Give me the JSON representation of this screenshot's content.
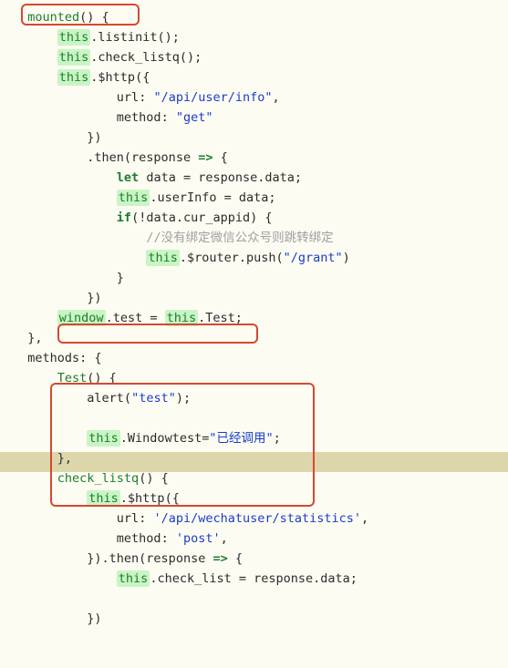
{
  "code": {
    "l1a": "mounted",
    "l1b": "() {",
    "l2a": "this",
    "l2b": ".listinit();",
    "l3a": "this",
    "l3b": ".check_listq();",
    "l4a": "this",
    "l4b": ".$http({",
    "l5a": "url",
    "l5b": ": ",
    "l5c": "\"/api/user/info\"",
    "l5d": ",",
    "l6a": "method",
    "l6b": ": ",
    "l6c": "\"get\"",
    "l7": "})",
    "l8a": ".then(response ",
    "l8b": "=>",
    "l8c": " {",
    "l9a": "let",
    "l9b": " data = response.data;",
    "l10a": "this",
    "l10b": ".userInfo = data;",
    "l11a": "if",
    "l11b": "(!data.cur_appid) {",
    "l12": "//没有绑定微信公众号则跳转绑定",
    "l13a": "this",
    "l13b": ".$router.push(",
    "l13c": "\"/grant\"",
    "l13d": ")",
    "l14": "}",
    "l15": "})",
    "l16a": "window",
    "l16b": ".test = ",
    "l16c": "this",
    "l16d": ".Test;",
    "l17": "},",
    "l18a": "methods",
    "l18b": ": {",
    "l19a": "Test",
    "l19b": "() {",
    "l20a": "alert(",
    "l20b": "\"test\"",
    "l20c": ");",
    "l21": "",
    "l22a": "this",
    "l22b": ".Windowtest=",
    "l22c": "\"已经调用\"",
    "l22d": ";",
    "l23": "},",
    "l24a": "check_listq",
    "l24b": "() {",
    "l25a": "this",
    "l25b": ".$http({",
    "l26a": "url",
    "l26b": ": ",
    "l26c": "'/api/wechatuser/statistics'",
    "l26d": ",",
    "l27a": "method",
    "l27b": ": ",
    "l27c": "'post'",
    "l27d": ",",
    "l28a": "}).then(response ",
    "l28b": "=>",
    "l28c": " {",
    "l29a": "this",
    "l29b": ".check_list = response.data;",
    "l30": "",
    "l31": "})"
  }
}
